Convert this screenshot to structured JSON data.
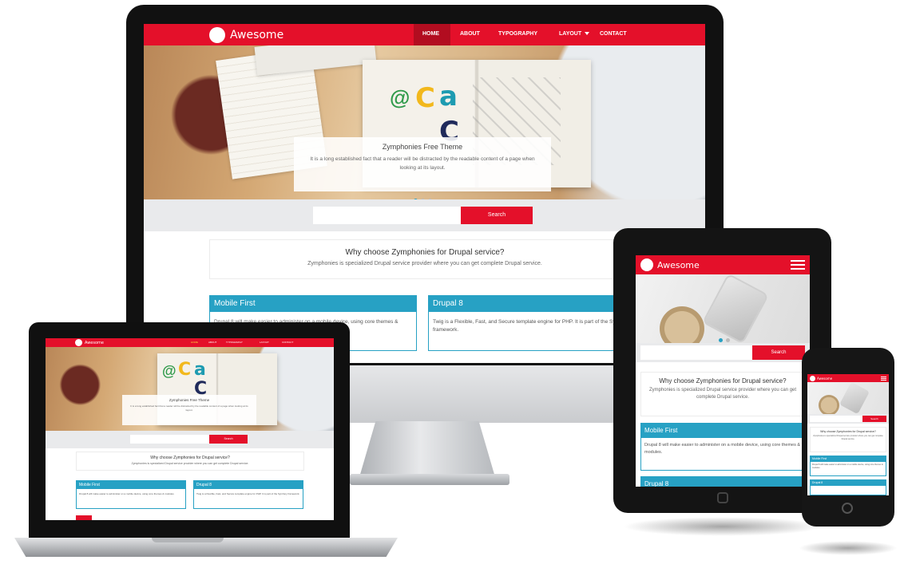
{
  "site": {
    "brand": "Awesome",
    "nav": {
      "home": "HOME",
      "about": "ABOUT",
      "typography": "TYPOGRAPHY",
      "layout": "LAYOUT",
      "contact": "CONTACT"
    },
    "hero": {
      "title": "Zymphonies Free Theme",
      "text": "It is a long established fact that a reader will be distracted by the readable content of a page when looking at its layout."
    },
    "search": {
      "button": "Search",
      "placeholder": ""
    },
    "why": {
      "title": "Why choose Zymphonies for Drupal service?",
      "text": "Zymphonies is specialized Drupal service provider where you can get complete Drupal service."
    },
    "cards": [
      {
        "title": "Mobile First",
        "text": "Drupal 8 will make easier to administer on a mobile device, using core themes & modules."
      },
      {
        "title": "Drupal 8",
        "text": "Twig is a Flexible, Fast, and Secure template engine for PHP. It is part of the Symfony framework."
      }
    ]
  },
  "colors": {
    "brand_red": "#e4102a",
    "accent_teal": "#27a1c4"
  }
}
